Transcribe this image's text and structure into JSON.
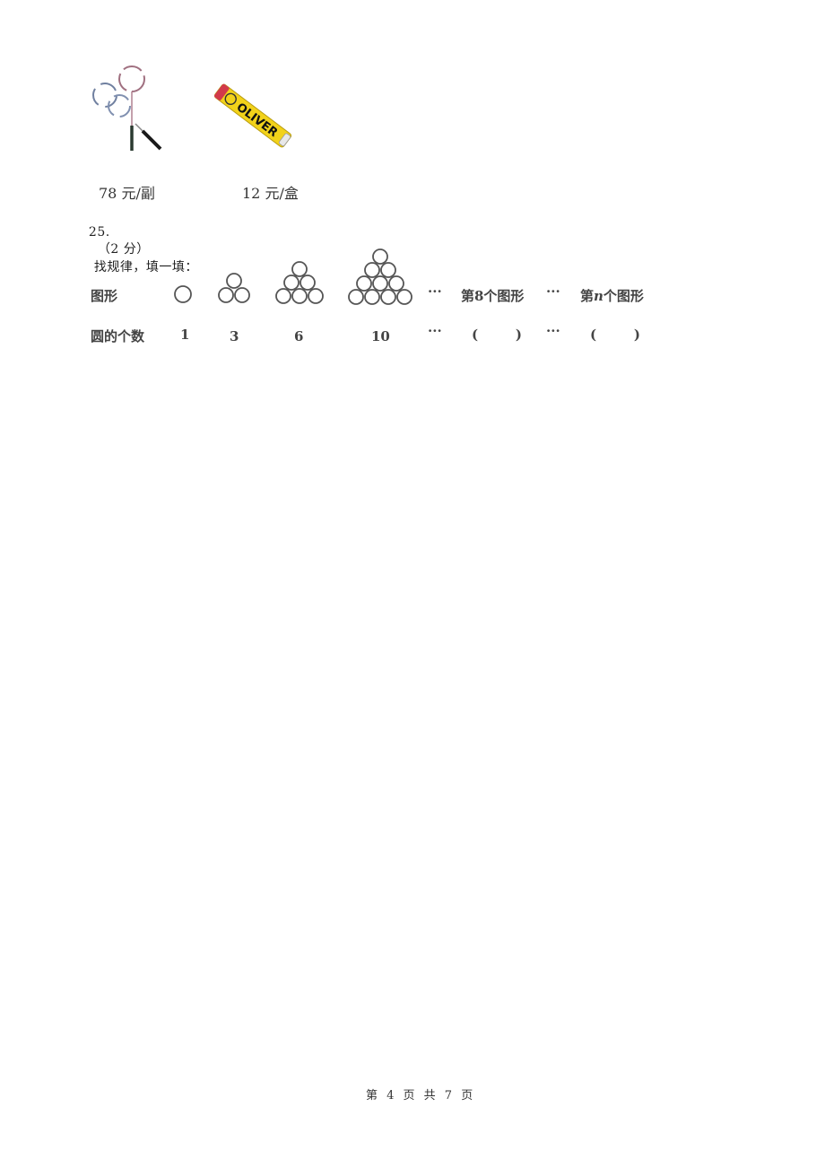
{
  "items": [
    {
      "name": "racket-pair",
      "price_label": "78 元/副"
    },
    {
      "name": "shuttlecock-tube",
      "price_label": "12 元/盒",
      "brand": "OLIVER"
    }
  ],
  "question": {
    "number": "25.",
    "score": "（2 分）",
    "prompt": "找规律，填一填："
  },
  "pattern_table": {
    "row_labels": {
      "figure": "图形",
      "count": "圆的个数"
    },
    "figures": [
      {
        "rows": 1,
        "count": "1"
      },
      {
        "rows": 2,
        "count": "3"
      },
      {
        "rows": 3,
        "count": "6"
      },
      {
        "rows": 4,
        "count": "10"
      }
    ],
    "ellipsis": "···",
    "eighth_label": "第8个图形",
    "nth_label_prefix": "第",
    "nth_label_var": "n",
    "nth_label_suffix": "个图形",
    "blank": "(        )"
  },
  "footer": {
    "page_text": "第 4 页 共 7 页"
  }
}
